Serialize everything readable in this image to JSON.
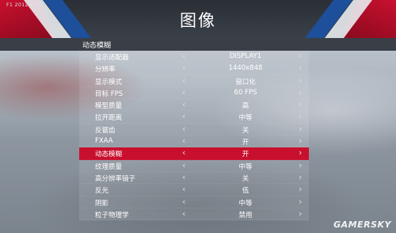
{
  "header": {
    "game_tag": "F1 2012 v1.0",
    "title": "图像"
  },
  "section": {
    "title": "动态模糊"
  },
  "settings": [
    {
      "label": "显示适配器",
      "value": "DISPLAY1",
      "selected": false
    },
    {
      "label": "分辨率",
      "value": "1440x848",
      "selected": false
    },
    {
      "label": "显示模式",
      "value": "窗口化",
      "selected": false
    },
    {
      "label": "目标 FPS",
      "value": "60 FPS",
      "selected": false
    },
    {
      "label": "模型质量",
      "value": "高",
      "selected": false
    },
    {
      "label": "拉开距离",
      "value": "中等",
      "selected": false
    },
    {
      "label": "反锯齿",
      "value": "关",
      "selected": false
    },
    {
      "label": "FXAA",
      "value": "开",
      "selected": false
    },
    {
      "label": "动态模糊",
      "value": "开",
      "selected": true
    },
    {
      "label": "纹理质量",
      "value": "中等",
      "selected": false
    },
    {
      "label": "高分辨率镜子",
      "value": "关",
      "selected": false
    },
    {
      "label": "反光",
      "value": "低",
      "selected": false
    },
    {
      "label": "阴影",
      "value": "中等",
      "selected": false
    },
    {
      "label": "粒子物理学",
      "value": "禁用",
      "selected": false
    }
  ],
  "arrows": {
    "left": "‹",
    "right": "›"
  },
  "watermark": "GAMERSKY",
  "colors": {
    "accent_red": "#c8102e",
    "accent_blue": "#1d4f9a",
    "header_bg": "#2a2f36"
  }
}
